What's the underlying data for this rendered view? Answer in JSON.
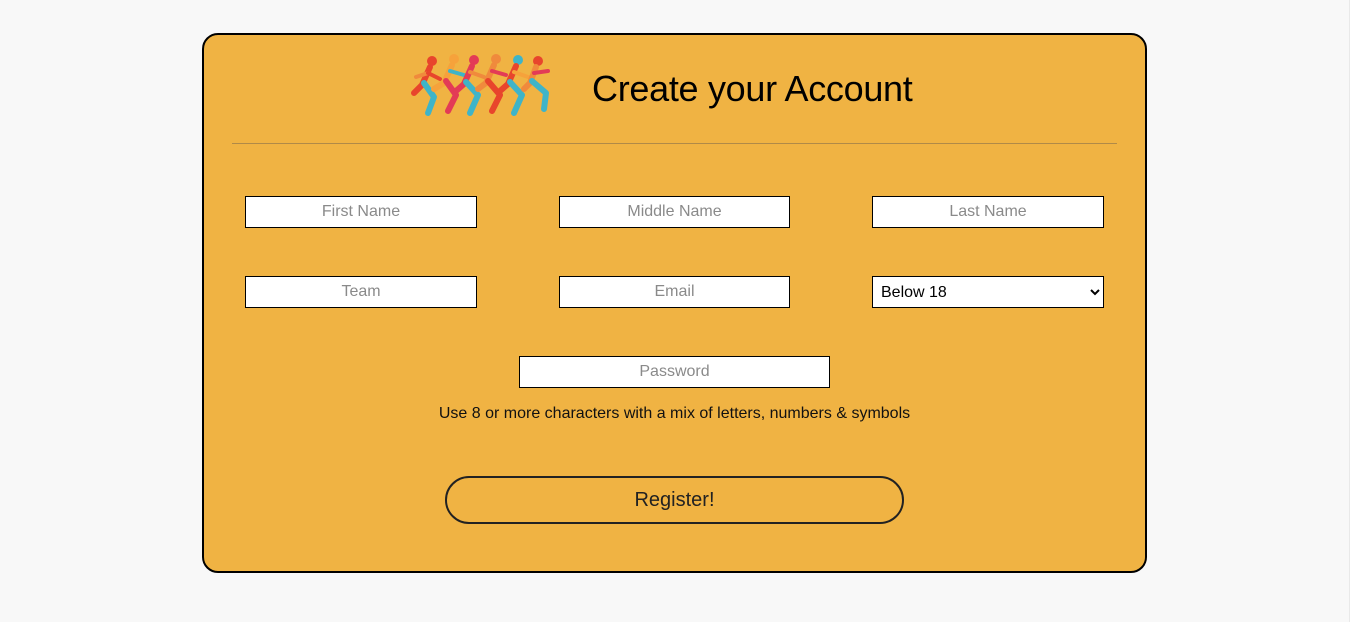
{
  "page": {
    "title": "Create your Account",
    "background": "#f8f8f8",
    "card_color": "#f0b343"
  },
  "logo": {
    "icon": "runners-logo-icon"
  },
  "form": {
    "first_name": {
      "placeholder": "First Name",
      "value": ""
    },
    "middle_name": {
      "placeholder": "Middle Name",
      "value": ""
    },
    "last_name": {
      "placeholder": "Last Name",
      "value": ""
    },
    "team": {
      "placeholder": "Team",
      "value": ""
    },
    "email": {
      "placeholder": "Email",
      "value": ""
    },
    "age_group": {
      "selected": "Below 18"
    },
    "password": {
      "placeholder": "Password",
      "value": ""
    },
    "password_hint": "Use 8 or more characters with a mix of letters, numbers & symbols",
    "register_label": "Register!"
  }
}
